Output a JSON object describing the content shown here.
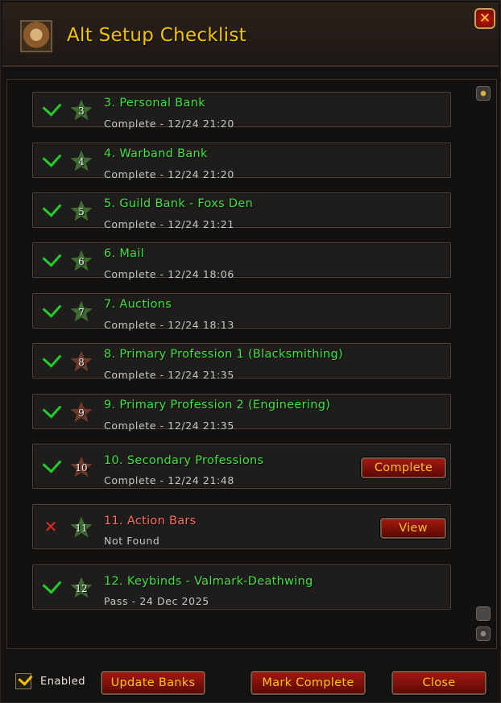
{
  "window": {
    "title": "Alt Setup Checklist"
  },
  "items": [
    {
      "number": "3",
      "title": "3. Personal Bank",
      "status": "Complete - 12/24 21:20",
      "state": "pass",
      "star_color": "#3f6b32"
    },
    {
      "number": "4",
      "title": "4. Warband Bank",
      "status": "Complete - 12/24 21:20",
      "state": "pass",
      "star_color": "#3f6b32"
    },
    {
      "number": "5",
      "title": "5. Guild Bank - Foxs Den",
      "status": "Complete - 12/24 21:21",
      "state": "pass",
      "star_color": "#3f6b32"
    },
    {
      "number": "6",
      "title": "6. Mail",
      "status": "Complete - 12/24 18:06",
      "state": "pass",
      "star_color": "#3f6b32"
    },
    {
      "number": "7",
      "title": "7. Auctions",
      "status": "Complete - 12/24 18:13",
      "state": "pass",
      "star_color": "#3f6b32"
    },
    {
      "number": "8",
      "title": "8. Primary Profession 1 (Blacksmithing)",
      "status": "Complete - 12/24 21:35",
      "state": "pass",
      "star_color": "#6b3a2a"
    },
    {
      "number": "9",
      "title": "9. Primary Profession 2 (Engineering)",
      "status": "Complete - 12/24 21:35",
      "state": "pass",
      "star_color": "#6b3a2a"
    },
    {
      "number": "10",
      "title": "10. Secondary Professions",
      "status": "Complete - 12/24 21:48",
      "state": "pass",
      "star_color": "#6b3a2a",
      "button": "Complete"
    },
    {
      "number": "11",
      "title": "11. Action Bars",
      "status": "Not Found",
      "state": "fail",
      "star_color": "#3f6b32",
      "button": "View"
    },
    {
      "number": "12",
      "title": "12. Keybinds - Valmark-Deathwing",
      "status": "Pass - 24 Dec 2025",
      "state": "pass",
      "star_color": "#3f6b32"
    }
  ],
  "footer": {
    "enabled_label": "Enabled",
    "enabled_checked": true,
    "update_banks": "Update Banks",
    "mark_complete": "Mark Complete",
    "close": "Close"
  },
  "colors": {
    "title_gold": "#f5c400",
    "complete_green": "#3fe33f",
    "fail_red": "#ff6f5e",
    "button_text": "#f7c320"
  }
}
